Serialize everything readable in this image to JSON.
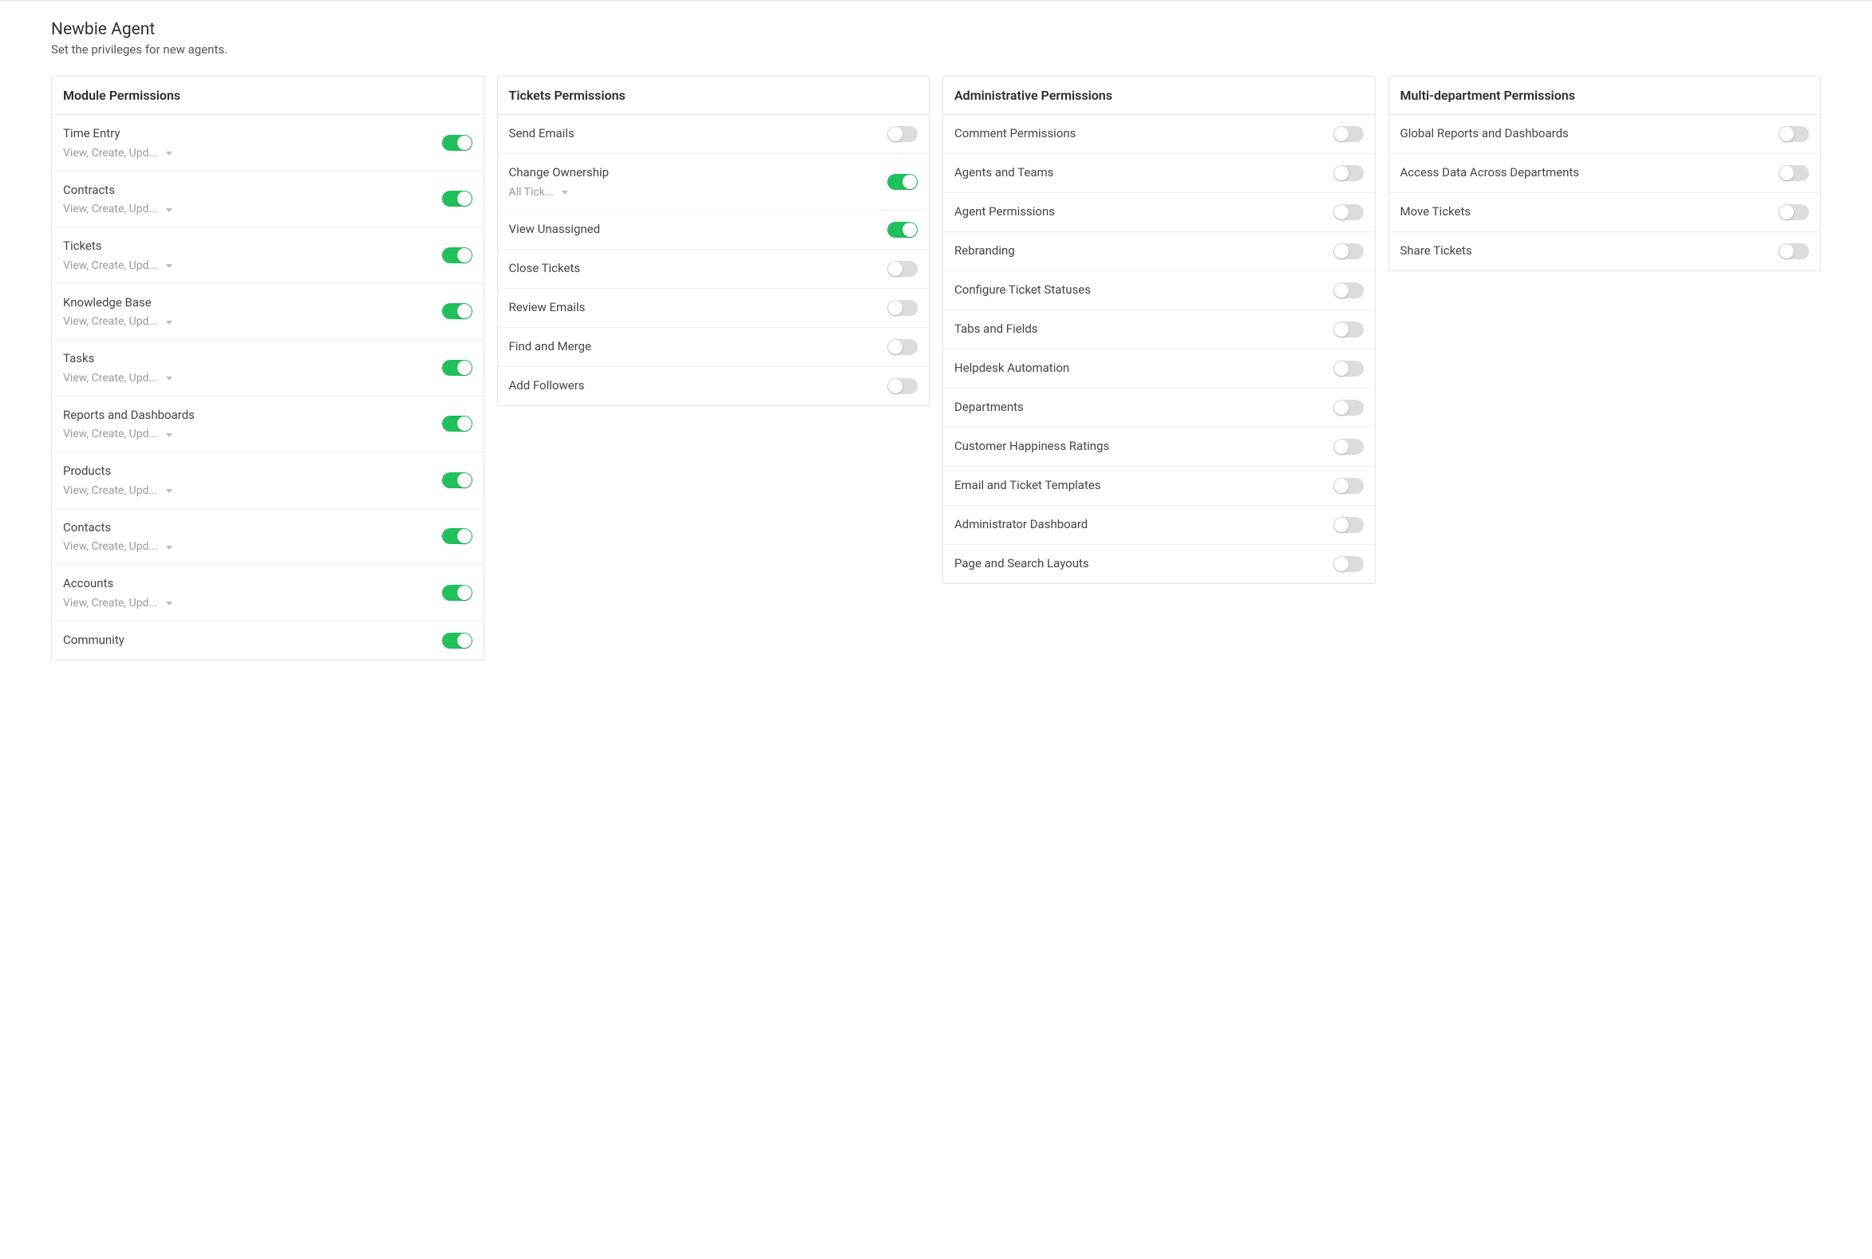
{
  "header": {
    "title": "Newbie Agent",
    "subtitle": "Set the privileges for new agents."
  },
  "columns": [
    {
      "title": "Module Permissions",
      "items": [
        {
          "label": "Time Entry",
          "sub": "View, Create, Upd...",
          "hasSub": true,
          "on": true
        },
        {
          "label": "Contracts",
          "sub": "View, Create, Upd...",
          "hasSub": true,
          "on": true
        },
        {
          "label": "Tickets",
          "sub": "View, Create, Upd...",
          "hasSub": true,
          "on": true
        },
        {
          "label": "Knowledge Base",
          "sub": "View, Create, Upd...",
          "hasSub": true,
          "on": true
        },
        {
          "label": "Tasks",
          "sub": "View, Create, Upd...",
          "hasSub": true,
          "on": true
        },
        {
          "label": "Reports and Dashboards",
          "sub": "View, Create, Upd...",
          "hasSub": true,
          "on": true
        },
        {
          "label": "Products",
          "sub": "View, Create, Upd...",
          "hasSub": true,
          "on": true
        },
        {
          "label": "Contacts",
          "sub": "View, Create, Upd...",
          "hasSub": true,
          "on": true
        },
        {
          "label": "Accounts",
          "sub": "View, Create, Upd...",
          "hasSub": true,
          "on": true
        },
        {
          "label": "Community",
          "hasSub": false,
          "on": true
        }
      ]
    },
    {
      "title": "Tickets Permissions",
      "items": [
        {
          "label": "Send Emails",
          "hasSub": false,
          "on": false
        },
        {
          "label": "Change Ownership",
          "sub": "All Tick...",
          "hasSub": true,
          "on": true,
          "subNarrow": true
        },
        {
          "label": "View Unassigned",
          "hasSub": false,
          "on": true
        },
        {
          "label": "Close Tickets",
          "hasSub": false,
          "on": false
        },
        {
          "label": "Review Emails",
          "hasSub": false,
          "on": false
        },
        {
          "label": "Find and Merge",
          "hasSub": false,
          "on": false
        },
        {
          "label": "Add Followers",
          "hasSub": false,
          "on": false
        }
      ]
    },
    {
      "title": "Administrative Permissions",
      "items": [
        {
          "label": "Comment Permissions",
          "hasSub": false,
          "on": false
        },
        {
          "label": "Agents and Teams",
          "hasSub": false,
          "on": false
        },
        {
          "label": "Agent Permissions",
          "hasSub": false,
          "on": false
        },
        {
          "label": "Rebranding",
          "hasSub": false,
          "on": false
        },
        {
          "label": "Configure Ticket Statuses",
          "hasSub": false,
          "on": false
        },
        {
          "label": "Tabs and Fields",
          "hasSub": false,
          "on": false
        },
        {
          "label": "Helpdesk Automation",
          "hasSub": false,
          "on": false
        },
        {
          "label": "Departments",
          "hasSub": false,
          "on": false
        },
        {
          "label": "Customer Happiness Ratings",
          "hasSub": false,
          "on": false
        },
        {
          "label": "Email and Ticket Templates",
          "hasSub": false,
          "on": false
        },
        {
          "label": "Administrator Dashboard",
          "hasSub": false,
          "on": false
        },
        {
          "label": "Page and Search Layouts",
          "hasSub": false,
          "on": false
        }
      ]
    },
    {
      "title": "Multi-department Permissions",
      "items": [
        {
          "label": "Global Reports and Dashboards",
          "hasSub": false,
          "on": false
        },
        {
          "label": "Access Data Across Departments",
          "hasSub": false,
          "on": false
        },
        {
          "label": "Move Tickets",
          "hasSub": false,
          "on": false
        },
        {
          "label": "Share Tickets",
          "hasSub": false,
          "on": false
        }
      ]
    }
  ]
}
